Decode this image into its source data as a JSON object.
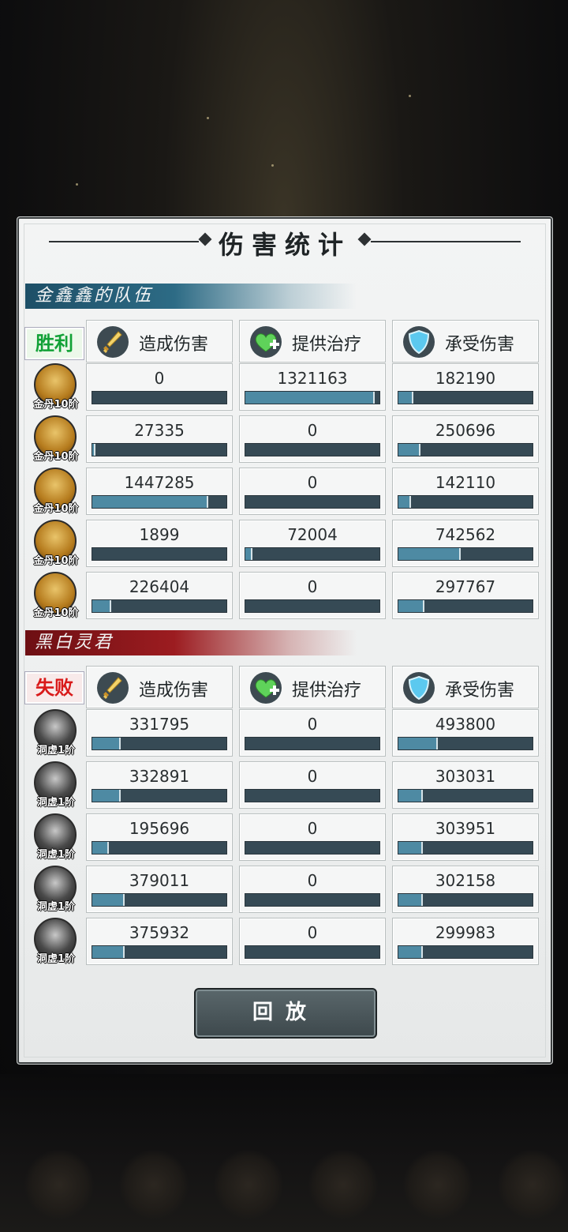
{
  "title": "伤害统计",
  "team1": {
    "name": "金鑫鑫的队伍",
    "result": "胜利",
    "headers": [
      "造成伤害",
      "提供治疗",
      "承受伤害"
    ],
    "rows": [
      {
        "rank": "金丹10阶",
        "stats": [
          {
            "value": "0",
            "fill": 0.0
          },
          {
            "value": "1321163",
            "fill": 0.95
          },
          {
            "value": "182190",
            "fill": 0.1
          }
        ]
      },
      {
        "rank": "金丹10阶",
        "stats": [
          {
            "value": "27335",
            "fill": 0.01
          },
          {
            "value": "0",
            "fill": 0.0
          },
          {
            "value": "250696",
            "fill": 0.15
          }
        ]
      },
      {
        "rank": "金丹10阶",
        "stats": [
          {
            "value": "1447285",
            "fill": 0.85
          },
          {
            "value": "0",
            "fill": 0.0
          },
          {
            "value": "142110",
            "fill": 0.08
          }
        ]
      },
      {
        "rank": "金丹10阶",
        "stats": [
          {
            "value": "1899",
            "fill": 0.0
          },
          {
            "value": "72004",
            "fill": 0.04
          },
          {
            "value": "742562",
            "fill": 0.45
          }
        ]
      },
      {
        "rank": "金丹10阶",
        "stats": [
          {
            "value": "226404",
            "fill": 0.13
          },
          {
            "value": "0",
            "fill": 0.0
          },
          {
            "value": "297767",
            "fill": 0.18
          }
        ]
      }
    ]
  },
  "team2": {
    "name": "黑白灵君",
    "result": "失败",
    "headers": [
      "造成伤害",
      "提供治疗",
      "承受伤害"
    ],
    "rows": [
      {
        "rank": "洞虚1阶",
        "stats": [
          {
            "value": "331795",
            "fill": 0.2
          },
          {
            "value": "0",
            "fill": 0.0
          },
          {
            "value": "493800",
            "fill": 0.28
          }
        ]
      },
      {
        "rank": "洞虚1阶",
        "stats": [
          {
            "value": "332891",
            "fill": 0.2
          },
          {
            "value": "0",
            "fill": 0.0
          },
          {
            "value": "303031",
            "fill": 0.17
          }
        ]
      },
      {
        "rank": "洞虚1阶",
        "stats": [
          {
            "value": "195696",
            "fill": 0.11
          },
          {
            "value": "0",
            "fill": 0.0
          },
          {
            "value": "303951",
            "fill": 0.17
          }
        ]
      },
      {
        "rank": "洞虚1阶",
        "stats": [
          {
            "value": "379011",
            "fill": 0.23
          },
          {
            "value": "0",
            "fill": 0.0
          },
          {
            "value": "302158",
            "fill": 0.17
          }
        ]
      },
      {
        "rank": "洞虚1阶",
        "stats": [
          {
            "value": "375932",
            "fill": 0.23
          },
          {
            "value": "0",
            "fill": 0.0
          },
          {
            "value": "299983",
            "fill": 0.17
          }
        ]
      }
    ]
  },
  "replay_label": "回放",
  "icons": [
    "sword-icon",
    "heart-plus-icon",
    "shield-icon"
  ],
  "colors": {
    "win": "#11a136",
    "lose": "#d91a1a",
    "bar_fill": "#4e8aa3",
    "bar_track": "#364a55"
  }
}
